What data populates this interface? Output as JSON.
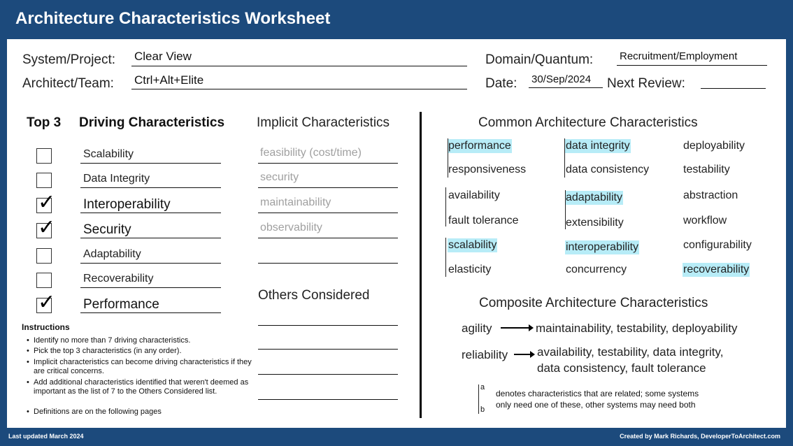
{
  "header": {
    "title": "Architecture Characteristics Worksheet"
  },
  "form": {
    "system_label": "System/Project:",
    "system_value": "Clear View",
    "architect_label": "Architect/Team:",
    "architect_value": "Ctrl+Alt+Elite",
    "domain_label": "Domain/Quantum:",
    "domain_value": "Recruitment/Employment",
    "date_label": "Date:",
    "date_value": "30/Sep/2024",
    "review_label": "Next Review:",
    "review_value": ""
  },
  "driving": {
    "top3_header": "Top 3",
    "header": "Driving Characteristics",
    "items": [
      {
        "label": "Scalability",
        "checked": false
      },
      {
        "label": "Data Integrity",
        "checked": false
      },
      {
        "label": "Interoperability",
        "checked": true
      },
      {
        "label": "Security",
        "checked": true
      },
      {
        "label": "Adaptability",
        "checked": false
      },
      {
        "label": "Recoverability",
        "checked": false
      },
      {
        "label": "Performance",
        "checked": true
      }
    ],
    "check_glyph": "✓"
  },
  "implicit": {
    "header": "Implicit Characteristics",
    "items": [
      "feasibility (cost/time)",
      "security",
      "maintainability",
      "observability",
      ""
    ]
  },
  "others": {
    "header": "Others Considered",
    "items": [
      "",
      "",
      "",
      ""
    ]
  },
  "instructions": {
    "title": "Instructions",
    "items": [
      "Identify no more than 7 driving characteristics.",
      "Pick the top 3 characteristics (in any order).",
      "Implicit characteristics can become driving characteristics if they are critical concerns.",
      "Add additional characteristics identified that weren't deemed as important as the list of 7 to the Others Considered list.",
      "Definitions are on the following pages"
    ]
  },
  "common": {
    "header": "Common Architecture Characteristics",
    "highlight_color": "#b7ecf7",
    "items": [
      {
        "label": "performance",
        "hl": true
      },
      {
        "label": "data integrity",
        "hl": true
      },
      {
        "label": "deployability",
        "hl": false
      },
      {
        "label": "responsiveness",
        "hl": false
      },
      {
        "label": "data consistency",
        "hl": false
      },
      {
        "label": "testability",
        "hl": false
      },
      {
        "label": "availability",
        "hl": false
      },
      {
        "label": "adaptability",
        "hl": true
      },
      {
        "label": "abstraction",
        "hl": false
      },
      {
        "label": "fault tolerance",
        "hl": false
      },
      {
        "label": "extensibility",
        "hl": false
      },
      {
        "label": "workflow",
        "hl": false
      },
      {
        "label": "scalability",
        "hl": true
      },
      {
        "label": "interoperability",
        "hl": true
      },
      {
        "label": "configurability",
        "hl": false
      },
      {
        "label": "elasticity",
        "hl": false
      },
      {
        "label": "concurrency",
        "hl": false
      },
      {
        "label": "recoverability",
        "hl": true
      }
    ]
  },
  "composite": {
    "header": "Composite Architecture Characteristics",
    "agility_label": "agility",
    "agility_value": "maintainability, testability, deployability",
    "reliability_label": "reliability",
    "reliability_value_1": "availability, testability, data integrity,",
    "reliability_value_2": "data consistency, fault tolerance"
  },
  "legend": {
    "a": "a",
    "b": "b",
    "line1": "denotes characteristics that are related; some systems",
    "line2": "only need one of these, other systems may need both"
  },
  "footer": {
    "left": "Last updated March 2024",
    "right": "Created by Mark Richards, DeveloperToArchitect.com"
  }
}
